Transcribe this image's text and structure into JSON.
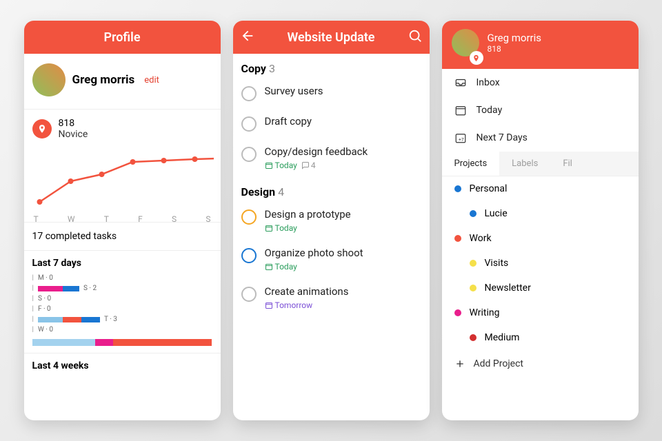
{
  "accent": "#f2533e",
  "profile": {
    "header": "Profile",
    "name": "Greg morris",
    "edit": "edit",
    "karma": "818",
    "rank": "Novice",
    "completed": "17 completed tasks",
    "last7": "Last 7 days",
    "last4": "Last 4 weeks",
    "day_legend": [
      "T",
      "W",
      "T",
      "F",
      "S",
      "S"
    ],
    "bars": [
      {
        "label": "M · 0"
      },
      {
        "label": "S · 2"
      },
      {
        "label": "S · 0"
      },
      {
        "label": "F · 0"
      },
      {
        "label": "T · 3"
      },
      {
        "label": "W · 0"
      }
    ]
  },
  "chart_data": {
    "type": "line",
    "categories": [
      "T",
      "W",
      "T",
      "F",
      "S",
      "S"
    ],
    "values": [
      0,
      40,
      55,
      78,
      80,
      82
    ],
    "ylim": [
      0,
      100
    ],
    "color": "#f2533e"
  },
  "update": {
    "header": "Website Update",
    "sections": [
      {
        "title": "Copy",
        "count": "3",
        "tasks": [
          {
            "title": "Survey users"
          },
          {
            "title": "Draft copy"
          },
          {
            "title": "Copy/design feedback",
            "today": "Today",
            "comments": "4"
          }
        ]
      },
      {
        "title": "Design",
        "count": "4",
        "tasks": [
          {
            "title": "Design a prototype",
            "today": "Today",
            "ring": "#f5a623"
          },
          {
            "title": "Organize photo shoot",
            "today": "Today",
            "ring": "#1976d2"
          },
          {
            "title": "Create animations",
            "tomorrow": "Tomorrow"
          }
        ]
      }
    ]
  },
  "sidebar": {
    "name": "Greg morris",
    "points": "818",
    "menu": [
      {
        "icon": "inbox",
        "label": "Inbox"
      },
      {
        "icon": "today",
        "label": "Today"
      },
      {
        "icon": "week",
        "label": "Next 7 Days"
      }
    ],
    "tabs": [
      "Projects",
      "Labels",
      "Fil"
    ],
    "projects": [
      {
        "color": "#1976d2",
        "label": "Personal"
      },
      {
        "color": "#1976d2",
        "label": "Lucie",
        "child": true
      },
      {
        "color": "#f2533e",
        "label": "Work"
      },
      {
        "color": "#f5e04a",
        "label": "Visits",
        "child": true
      },
      {
        "color": "#f5e04a",
        "label": "Newsletter",
        "child": true
      },
      {
        "color": "#e91e8c",
        "label": "Writing"
      },
      {
        "color": "#d32f2f",
        "label": "Medium",
        "child": true
      }
    ],
    "add": "Add Project"
  }
}
